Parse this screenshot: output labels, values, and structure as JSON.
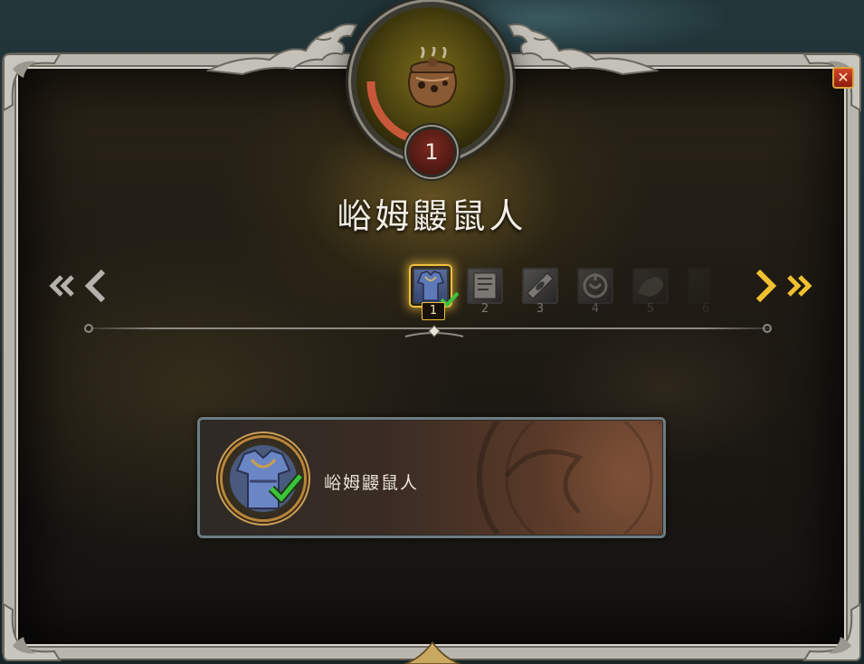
{
  "window": {
    "close_label": "✕"
  },
  "header": {
    "level": "1",
    "title": "峪姆鼹鼠人",
    "icon": "clay-pot-icon"
  },
  "stages": [
    {
      "number": "1",
      "icon": "tunic-icon",
      "state": "active",
      "completed": true
    },
    {
      "number": "2",
      "icon": "parchment-icon",
      "state": "locked",
      "completed": false
    },
    {
      "number": "3",
      "icon": "tablet-icon",
      "state": "locked",
      "completed": false
    },
    {
      "number": "4",
      "icon": "shield-emblem-icon",
      "state": "locked",
      "completed": false
    },
    {
      "number": "5",
      "icon": "beast-icon",
      "state": "locked",
      "completed": false
    },
    {
      "number": "6",
      "icon": "unknown-icon",
      "state": "locked",
      "completed": false
    }
  ],
  "navigation": {
    "first": "«",
    "prev": "‹",
    "next": "›",
    "last": "»"
  },
  "reward": {
    "label": "峪姆鼹鼠人",
    "icon": "tunic-icon",
    "completed": true
  },
  "colors": {
    "accent_gold": "#f0c040",
    "check_green": "#3cc23c",
    "close_red": "#c0301c"
  }
}
